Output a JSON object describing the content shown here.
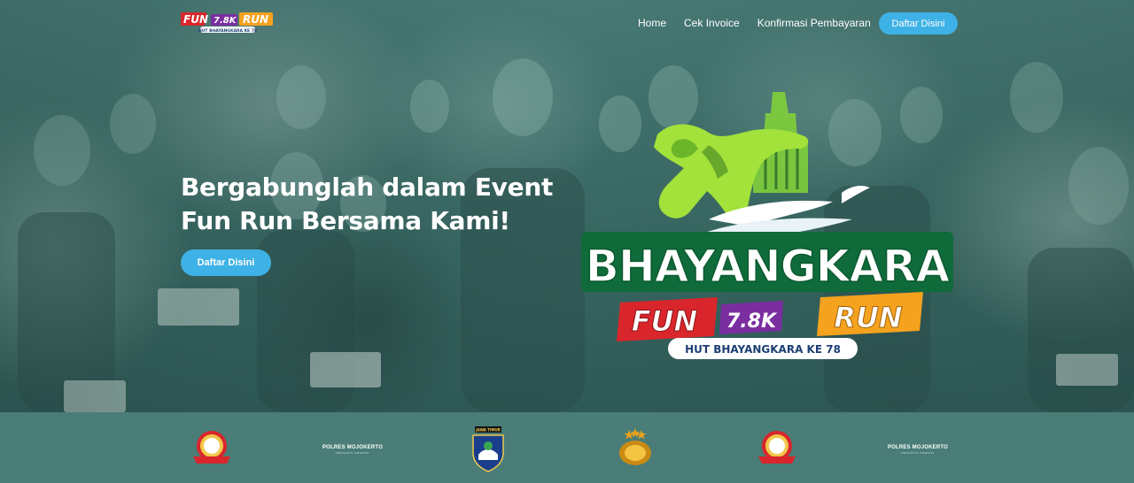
{
  "navbar": {
    "brand_fun": "FUN",
    "brand_distance": "7.8K",
    "brand_run": "RUN",
    "brand_tagline": "HUT BHAYANGKARA KE 78",
    "links": [
      "Home",
      "Cek Invoice",
      "Konfirmasi Pembayaran"
    ],
    "cta_label": "Daftar Disini"
  },
  "hero": {
    "title_line1": "Bergabunglah dalam Event",
    "title_line2": "Fun Run Bersama Kami!",
    "cta_label": "Daftar Disini"
  },
  "event_logo": {
    "name": "BHAYANGKARA",
    "fun": "FUN",
    "distance": "7.8K",
    "run": "RUN",
    "tagline": "HUT BHAYANGKARA KE 78"
  },
  "sponsors": {
    "polres_label": "POLRES MOJOKERTO",
    "polres_sub": "PRASASTI PRESISI",
    "jatim_label": "JAWA TIMUR"
  },
  "colors": {
    "accent": "#3eb2e6",
    "hero_overlay": "#3f6f6b",
    "strip": "#4a7d77",
    "logo_green": "#9ee03a",
    "logo_red": "#d8262c",
    "logo_purple": "#7a2ea0",
    "logo_orange": "#f5a21e"
  }
}
